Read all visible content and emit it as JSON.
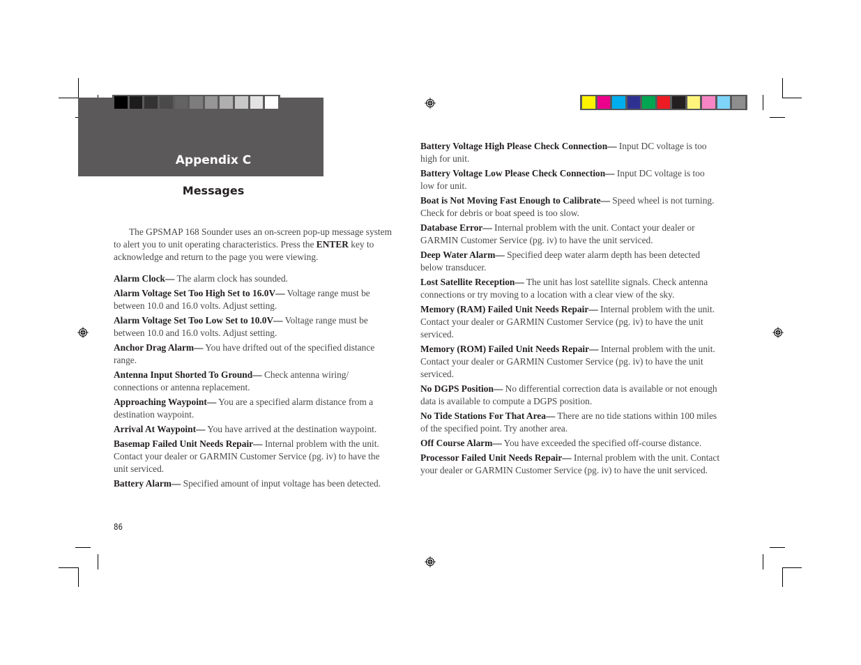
{
  "header": {
    "appendix": "Appendix C",
    "section": "Messages",
    "band_color": "#5b595a"
  },
  "grayscale_swatches": [
    "#000000",
    "#1c1c1c",
    "#333333",
    "#4a4a4a",
    "#636363",
    "#7d7d7d",
    "#969696",
    "#afafaf",
    "#c8c8c8",
    "#e3e3e3",
    "#ffffff"
  ],
  "color_swatches": [
    "#fff200",
    "#ec008c",
    "#00aeef",
    "#2e3192",
    "#00a651",
    "#ed1c24",
    "#231f20",
    "#fff57c",
    "#f784c4",
    "#7dd4f8",
    "#8e8e8e"
  ],
  "intro": {
    "before": "The GPSMAP 168 Sounder uses an on-screen pop-up message system to alert you to unit operating characteristics. Press the ",
    "key": "ENTER",
    "after": " key to acknowledge and return to the page you were viewing."
  },
  "left_messages": [
    {
      "term": "Alarm Clock—",
      "desc": " The alarm clock has sounded."
    },
    {
      "term": "Alarm Voltage Set Too High Set to 16.0V—",
      "desc": " Voltage range must be between 10.0 and 16.0 volts. Adjust setting."
    },
    {
      "term": "Alarm Voltage Set Too Low Set to 10.0V—",
      "desc": " Voltage range must be between 10.0 and 16.0 volts. Adjust setting."
    },
    {
      "term": "Anchor Drag Alarm—",
      "desc": " You have drifted out of the specified distance range."
    },
    {
      "term": "Antenna Input Shorted To Ground—",
      "desc": " Check antenna wiring/ connections or antenna replacement."
    },
    {
      "term": "Approaching Waypoint—",
      "desc": " You are a specified alarm distance from a destination waypoint."
    },
    {
      "term": "Arrival At Waypoint—",
      "desc": " You have arrived at the destination waypoint."
    },
    {
      "term": "Basemap Failed Unit Needs Repair—",
      "desc": " Internal problem with the unit. Contact your dealer or GARMIN Customer Service (pg. iv) to have the unit serviced."
    },
    {
      "term": "Battery Alarm—",
      "desc": " Specified amount of input voltage has been detected."
    }
  ],
  "right_messages": [
    {
      "term": "Battery Voltage High Please Check Connection—",
      "desc": " Input DC voltage is too high for unit."
    },
    {
      "term": "Battery Voltage Low Please Check Connection—",
      "desc": " Input DC voltage is too low for unit."
    },
    {
      "term": "Boat is Not Moving Fast Enough to Calibrate—",
      "desc": " Speed wheel is not turning. Check for debris or boat speed is too slow."
    },
    {
      "term": "Database Error—",
      "desc": " Internal problem with the unit. Contact your dealer or GARMIN Customer Service (pg. iv) to have the unit serviced."
    },
    {
      "term": "Deep Water Alarm—",
      "desc": " Specified deep water alarm depth has been detected below transducer."
    },
    {
      "term": "Lost Satellite Reception—",
      "desc": " The unit has lost satellite signals. Check antenna connections or try moving to a location with a clear view of the sky."
    },
    {
      "term": "Memory (RAM) Failed Unit Needs Repair—",
      "desc": " Internal problem with the unit. Contact your dealer or GARMIN Customer Service (pg. iv) to have the unit serviced."
    },
    {
      "term": "Memory (ROM) Failed Unit Needs Repair—",
      "desc": " Internal problem with the unit. Contact your dealer or GARMIN Customer Service (pg. iv) to have the unit serviced."
    },
    {
      "term": "No DGPS Position—",
      "desc": " No differential correction data is available or not enough data is available to compute a DGPS position."
    },
    {
      "term": "No Tide Stations For That Area—",
      "desc": " There are no tide stations within 100 miles of the specified point. Try another area."
    },
    {
      "term": "Off Course Alarm—",
      "desc": " You have exceeded the specified off-course distance."
    },
    {
      "term": "Processor Failed Unit Needs Repair—",
      "desc": " Internal problem with the unit. Contact your dealer or GARMIN Customer Service (pg. iv) to have the unit serviced."
    }
  ],
  "footer": {
    "page_number": "86"
  }
}
